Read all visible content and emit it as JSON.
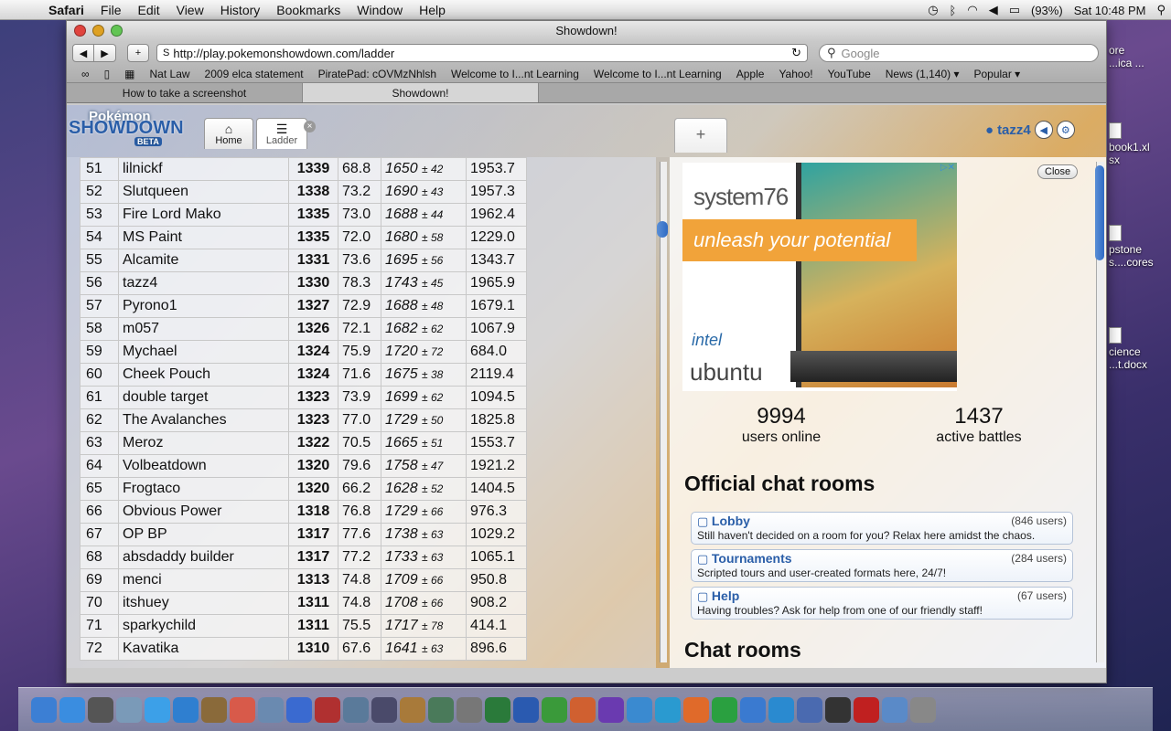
{
  "menubar": {
    "app": "Safari",
    "items": [
      "File",
      "Edit",
      "View",
      "History",
      "Bookmarks",
      "Window",
      "Help"
    ],
    "battery": "(93%)",
    "clock": "Sat 10:48 PM"
  },
  "desktop_icons": [
    {
      "label": "ore\n...ica ..."
    },
    {
      "label": "book1.xl\nsx"
    },
    {
      "label": "pstone\ns....cores"
    },
    {
      "label": "cience\n...t.docx"
    }
  ],
  "window": {
    "title": "Showdown!",
    "url": "http://play.pokemonshowdown.com/ladder",
    "search_placeholder": "Google",
    "bookmarks": [
      "Nat Law",
      "2009 elca statement",
      "PiratePad: cOVMzNhlsh",
      "Welcome to I...nt Learning",
      "Welcome to I...nt Learning",
      "Apple",
      "Yahoo!",
      "YouTube",
      "News (1,140) ▾",
      "Popular ▾"
    ],
    "tabs": [
      {
        "label": "How to take a screenshot",
        "active": false
      },
      {
        "label": "Showdown!",
        "active": true
      }
    ]
  },
  "page": {
    "logo": {
      "line1": "Pokémon",
      "line2": "SHOWDOWN",
      "badge": "BETA"
    },
    "tabs": [
      {
        "label": "Home",
        "icon": "home-icon"
      },
      {
        "label": "Ladder",
        "icon": "list-icon"
      }
    ],
    "new_tab": "+",
    "username": "tazz4",
    "ladder_rows": [
      {
        "rank": "51",
        "name": "lilnickf",
        "elo": "1339",
        "gxe": "68.8",
        "glicko": "1650",
        "dev": "± 42",
        "coil": "1953.7"
      },
      {
        "rank": "52",
        "name": "Slutqueen",
        "elo": "1338",
        "gxe": "73.2",
        "glicko": "1690",
        "dev": "± 43",
        "coil": "1957.3"
      },
      {
        "rank": "53",
        "name": "Fire Lord Mako",
        "elo": "1335",
        "gxe": "73.0",
        "glicko": "1688",
        "dev": "± 44",
        "coil": "1962.4"
      },
      {
        "rank": "54",
        "name": "MS Paint",
        "elo": "1335",
        "gxe": "72.0",
        "glicko": "1680",
        "dev": "± 58",
        "coil": "1229.0"
      },
      {
        "rank": "55",
        "name": "Alcamite",
        "elo": "1331",
        "gxe": "73.6",
        "glicko": "1695",
        "dev": "± 56",
        "coil": "1343.7"
      },
      {
        "rank": "56",
        "name": "tazz4",
        "elo": "1330",
        "gxe": "78.3",
        "glicko": "1743",
        "dev": "± 45",
        "coil": "1965.9"
      },
      {
        "rank": "57",
        "name": "Pyrono1",
        "elo": "1327",
        "gxe": "72.9",
        "glicko": "1688",
        "dev": "± 48",
        "coil": "1679.1"
      },
      {
        "rank": "58",
        "name": "m057",
        "elo": "1326",
        "gxe": "72.1",
        "glicko": "1682",
        "dev": "± 62",
        "coil": "1067.9"
      },
      {
        "rank": "59",
        "name": "Mychael",
        "elo": "1324",
        "gxe": "75.9",
        "glicko": "1720",
        "dev": "± 72",
        "coil": "684.0"
      },
      {
        "rank": "60",
        "name": "Cheek Pouch",
        "elo": "1324",
        "gxe": "71.6",
        "glicko": "1675",
        "dev": "± 38",
        "coil": "2119.4"
      },
      {
        "rank": "61",
        "name": "double target",
        "elo": "1323",
        "gxe": "73.9",
        "glicko": "1699",
        "dev": "± 62",
        "coil": "1094.5"
      },
      {
        "rank": "62",
        "name": "The Avalanches",
        "elo": "1323",
        "gxe": "77.0",
        "glicko": "1729",
        "dev": "± 50",
        "coil": "1825.8"
      },
      {
        "rank": "63",
        "name": "Meroz",
        "elo": "1322",
        "gxe": "70.5",
        "glicko": "1665",
        "dev": "± 51",
        "coil": "1553.7"
      },
      {
        "rank": "64",
        "name": "Volbeatdown",
        "elo": "1320",
        "gxe": "79.6",
        "glicko": "1758",
        "dev": "± 47",
        "coil": "1921.2"
      },
      {
        "rank": "65",
        "name": "Frogtaco",
        "elo": "1320",
        "gxe": "66.2",
        "glicko": "1628",
        "dev": "± 52",
        "coil": "1404.5"
      },
      {
        "rank": "66",
        "name": "Obvious Power",
        "elo": "1318",
        "gxe": "76.8",
        "glicko": "1729",
        "dev": "± 66",
        "coil": "976.3"
      },
      {
        "rank": "67",
        "name": "OP BP",
        "elo": "1317",
        "gxe": "77.6",
        "glicko": "1738",
        "dev": "± 63",
        "coil": "1029.2"
      },
      {
        "rank": "68",
        "name": "absdaddy builder",
        "elo": "1317",
        "gxe": "77.2",
        "glicko": "1733",
        "dev": "± 63",
        "coil": "1065.1"
      },
      {
        "rank": "69",
        "name": "menci",
        "elo": "1313",
        "gxe": "74.8",
        "glicko": "1709",
        "dev": "± 66",
        "coil": "950.8"
      },
      {
        "rank": "70",
        "name": "itshuey",
        "elo": "1311",
        "gxe": "74.8",
        "glicko": "1708",
        "dev": "± 66",
        "coil": "908.2"
      },
      {
        "rank": "71",
        "name": "sparkychild",
        "elo": "1311",
        "gxe": "75.5",
        "glicko": "1717",
        "dev": "± 78",
        "coil": "414.1"
      },
      {
        "rank": "72",
        "name": "Kavatika",
        "elo": "1310",
        "gxe": "67.6",
        "glicko": "1641",
        "dev": "± 63",
        "coil": "896.6"
      }
    ],
    "right": {
      "close": "Close",
      "ad": {
        "brand": "system76",
        "tagline": "unleash your potential",
        "intel": "intel",
        "ubuntu": "ubuntu"
      },
      "users_online": "9994",
      "users_online_label": "users online",
      "active_battles": "1437",
      "active_battles_label": "active battles",
      "official_heading": "Official chat rooms",
      "rooms": [
        {
          "name": "Lobby",
          "users": "(846 users)",
          "desc": "Still haven't decided on a room for you? Relax here amidst the chaos."
        },
        {
          "name": "Tournaments",
          "users": "(284 users)",
          "desc": "Scripted tours and user-created formats here, 24/7!"
        },
        {
          "name": "Help",
          "users": "(67 users)",
          "desc": "Having troubles? Ask for help from one of our friendly staff!"
        }
      ],
      "chat_heading": "Chat rooms"
    }
  },
  "dock_icons": [
    "finder",
    "app-store",
    "dashboard",
    "mail",
    "facetime",
    "safari",
    "address-book",
    "calendar",
    "preview",
    "itunes",
    "photo-booth",
    "iphoto",
    "imovie",
    "garageband",
    "time-machine",
    "system-preferences",
    "activity",
    "word",
    "excel",
    "powerpoint",
    "entourage",
    "messenger",
    "network",
    "p-app",
    "x-app",
    "contacts",
    "vpn",
    "xcode",
    "terminal",
    "pdf-app",
    "folders",
    "trash"
  ]
}
